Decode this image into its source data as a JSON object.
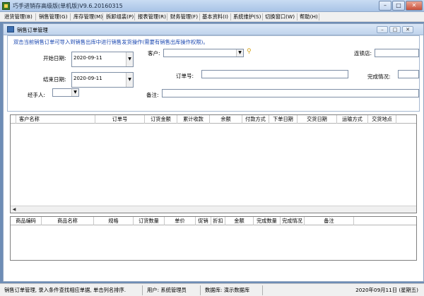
{
  "window": {
    "title": "巧手进销存高级版(单机版)V9.6.20160315",
    "controls": [
      "–",
      "□",
      "✕"
    ]
  },
  "menu": [
    "进货管理(B)",
    "销售管理(G)",
    "库存管理(M)",
    "拆卸组装(P)",
    "报表管理(R)",
    "财务管理(F)",
    "基本资料(I)",
    "系统维护(S)",
    "切换窗口(W)",
    "帮助(H)"
  ],
  "child": {
    "title": "销售订单管理",
    "controls": [
      "–",
      "□",
      "✕"
    ]
  },
  "form": {
    "hint": "双击当前销售订单可导入到销售出库中进行销售发货操作(需要有销售出库操作权限)。",
    "start_label": "开始日期:",
    "start_value": "2020-09-11",
    "end_label": "结束日期:",
    "end_value": "2020-09-11",
    "handler_label": "经手人:",
    "customer_label": "客户:",
    "order_no_label": "订单号:",
    "remark_label": "备注:",
    "chain_label": "连锁店:",
    "status_label": "完成情况:"
  },
  "orders_table": {
    "columns": [
      "客户名称",
      "订单号",
      "订货金额",
      "累计收款",
      "余额",
      "付款方式",
      "下单日期",
      "交货日期",
      "运输方式",
      "交货地点"
    ]
  },
  "items_table": {
    "columns": [
      "商品编码",
      "商品名称",
      "规格",
      "订货数量",
      "单价",
      "促销",
      "折扣",
      "金额",
      "完成数量",
      "完成情况",
      "备注"
    ]
  },
  "status": {
    "message": "销售订单管理, 录入条件查找相应单据, 单击列名排序.",
    "user": "用户: 系统管理员",
    "database": "数据库: 演示数据库",
    "date": "2020年09月11日 (星期五)"
  },
  "colors": {
    "desktop": "#6e8db5",
    "hint_text": "#1a47b0",
    "search_icon": "#d6a41a"
  }
}
